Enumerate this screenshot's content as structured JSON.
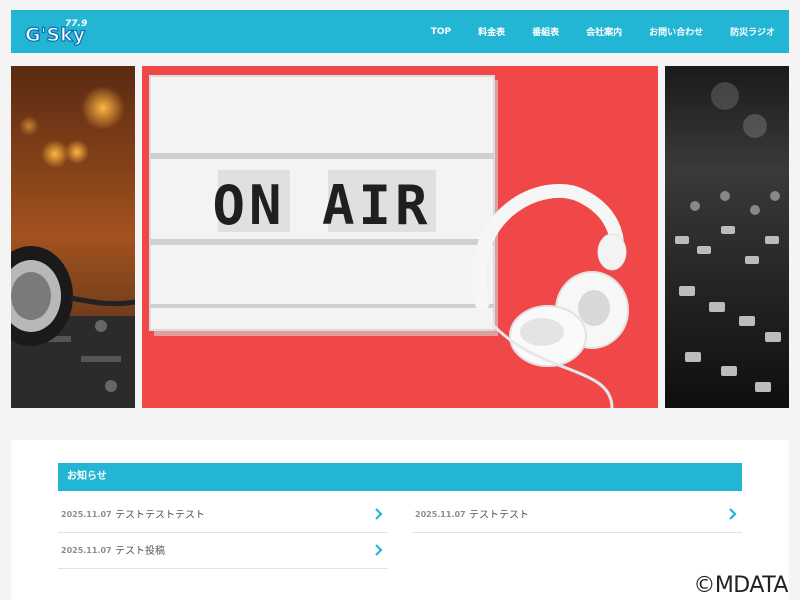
{
  "header": {
    "logo_text": "G'Sky",
    "logo_freq": "77.9",
    "nav": [
      "TOP",
      "料金表",
      "番組表",
      "会社案内",
      "お問い合わせ",
      "防災ラジオ"
    ]
  },
  "slider": {
    "board_text": "ON AIR"
  },
  "news": {
    "heading": "お知らせ",
    "items": [
      {
        "date": "2025.11.07",
        "title": "テストテストテスト"
      },
      {
        "date": "2025.11.07",
        "title": "テストテスト"
      },
      {
        "date": "2025.11.07",
        "title": "テスト投稿"
      }
    ]
  },
  "watermark": "©MDATA",
  "colors": {
    "brand": "#22b5d4",
    "slide_red": "#f04848"
  }
}
